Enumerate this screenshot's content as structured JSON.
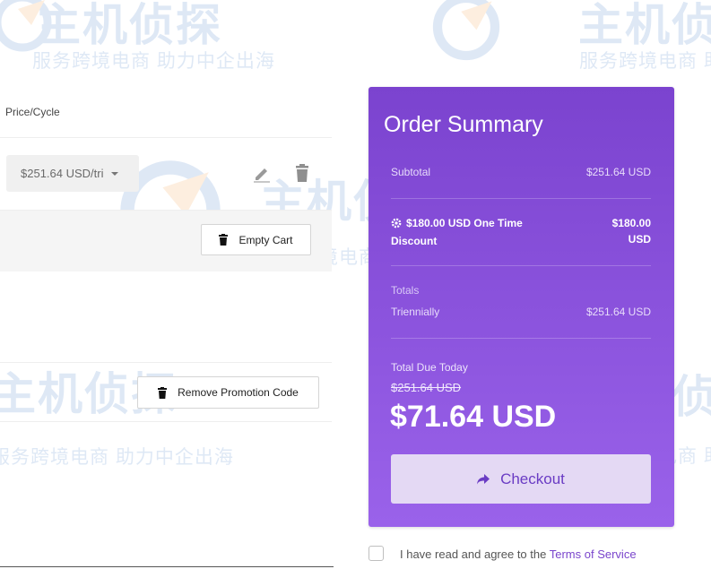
{
  "watermark": {
    "brand": "主机侦探",
    "tagline": "服务跨境电商 助力中企出海",
    "color": "#3a78c8"
  },
  "cart": {
    "column_header": "Price/Cycle",
    "cycle_select_value": "$251.64 USD/tri",
    "edit_icon": "pencil-icon",
    "delete_icon": "trash-icon",
    "empty_cart_label": "Empty Cart",
    "remove_promo_label": "Remove Promotion Code"
  },
  "summary": {
    "title": "Order Summary",
    "background_color": "#8a52dd",
    "subtotal_label": "Subtotal",
    "subtotal_value": "$251.64 USD",
    "discount_label_line1": "$180.00 USD One Time",
    "discount_label_line2": "Discount",
    "discount_value_line1": "$180.00",
    "discount_value_line2": "USD",
    "totals_label": "Totals",
    "cycle_label": "Triennially",
    "cycle_value": "$251.64 USD",
    "total_due_label": "Total Due Today",
    "original_price": "$251.64 USD",
    "total_price": "$71.64 USD",
    "checkout_label": "Checkout",
    "checkout_icon": "share-arrow-icon"
  },
  "terms": {
    "prefix": "I have read and agree to the",
    "link_text": "Terms of Service",
    "link_color": "#7a45cc"
  }
}
